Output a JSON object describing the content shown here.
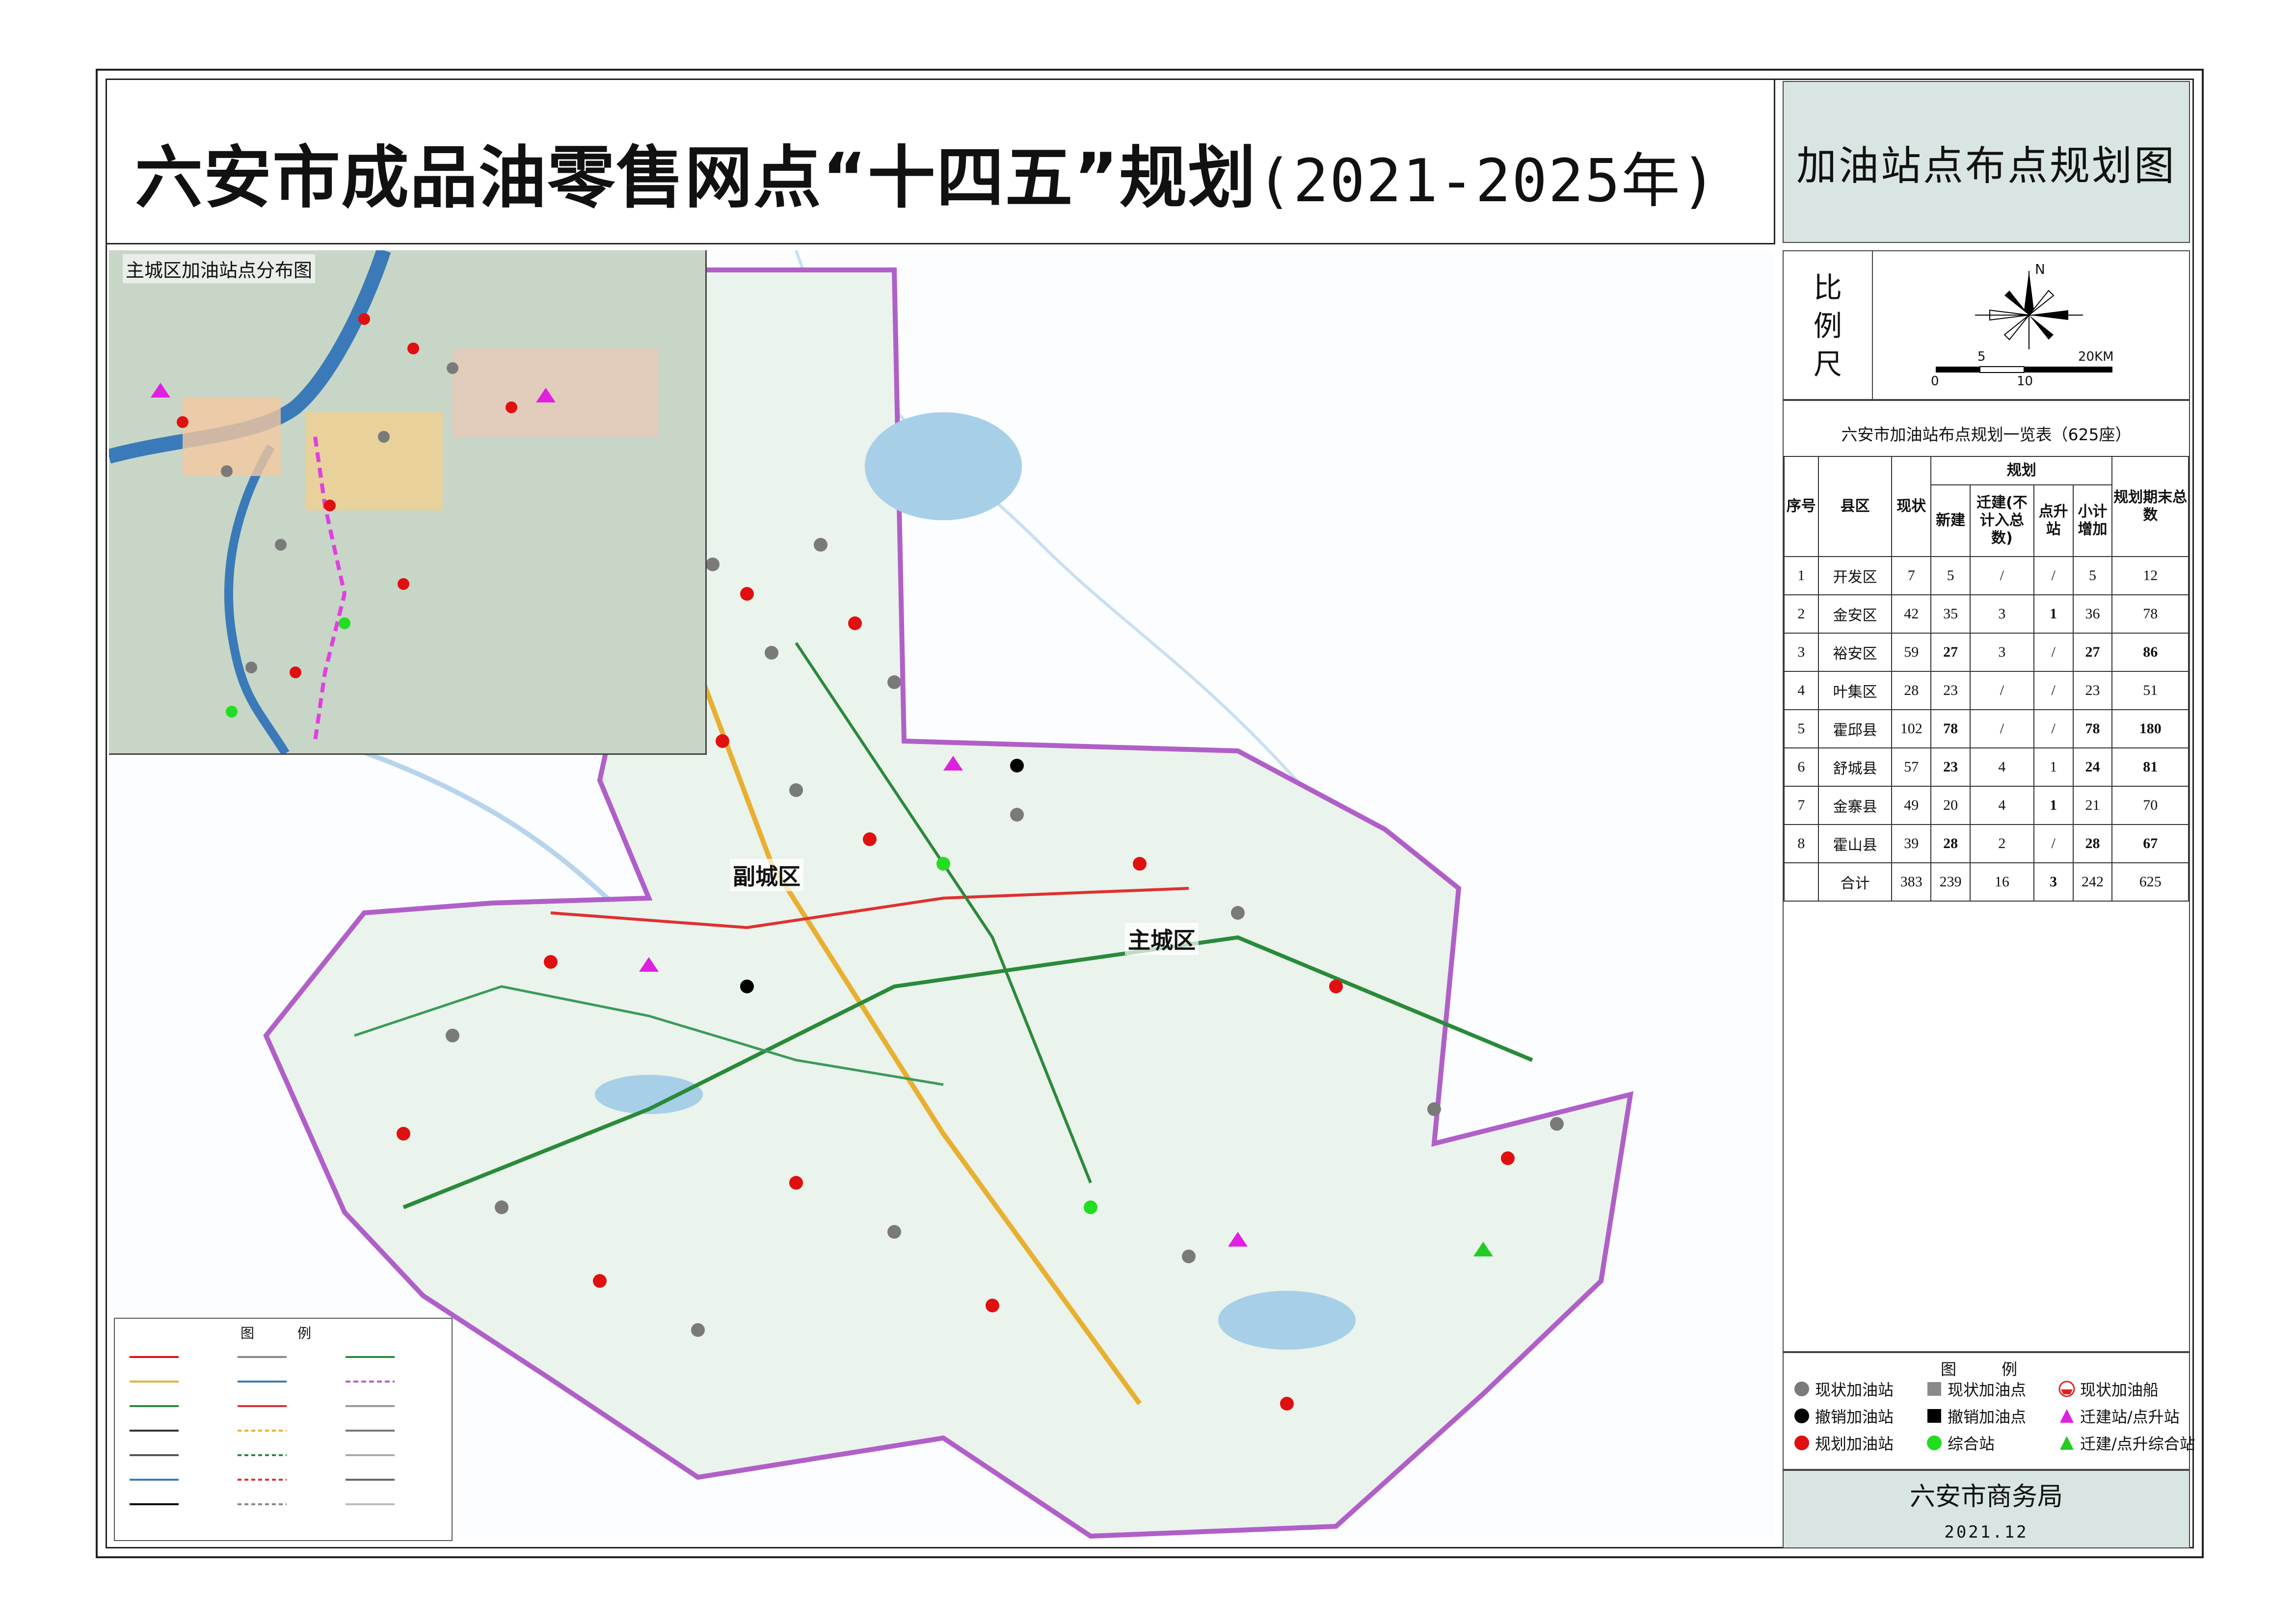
{
  "header": {
    "title_main": "六安市成品油零售网点“十四五”规划",
    "title_years": "(2021-2025年)",
    "subtitle": "加油站点布点规划图"
  },
  "inset": {
    "title": "主城区加油站点分布图"
  },
  "map": {
    "labels": {
      "sub_city": "副城区",
      "main_city": "主城区"
    },
    "legend_title": "图　例"
  },
  "scale": {
    "label": "比例尺",
    "north": "N",
    "ticks": [
      "0",
      "5",
      "10",
      "20KM"
    ]
  },
  "table": {
    "title": "六安市加油站布点规划一览表（625座）",
    "headers": {
      "seq": "序号",
      "district": "县区",
      "current": "现状",
      "plan": "规划",
      "new": "新建",
      "relocate": "迁建(不计入总数)",
      "upgrade": "点升站",
      "subtotal": "小计增加",
      "total": "规划期末总数"
    },
    "rows": [
      {
        "seq": "1",
        "district": "开发区",
        "current": "7",
        "new": "5",
        "relocate": "/",
        "upgrade": "/",
        "subtotal": "5",
        "total": "12"
      },
      {
        "seq": "2",
        "district": "金安区",
        "current": "42",
        "new": "35",
        "relocate": "3",
        "upgrade": "1",
        "subtotal": "36",
        "total": "78"
      },
      {
        "seq": "3",
        "district": "裕安区",
        "current": "59",
        "new": "27",
        "relocate": "3",
        "upgrade": "/",
        "subtotal": "27",
        "total": "86"
      },
      {
        "seq": "4",
        "district": "叶集区",
        "current": "28",
        "new": "23",
        "relocate": "/",
        "upgrade": "/",
        "subtotal": "23",
        "total": "51"
      },
      {
        "seq": "5",
        "district": "霍邱县",
        "current": "102",
        "new": "78",
        "relocate": "/",
        "upgrade": "/",
        "subtotal": "78",
        "total": "180"
      },
      {
        "seq": "6",
        "district": "舒城县",
        "current": "57",
        "new": "23",
        "relocate": "4",
        "upgrade": "1",
        "subtotal": "24",
        "total": "81"
      },
      {
        "seq": "7",
        "district": "金寨县",
        "current": "49",
        "new": "20",
        "relocate": "4",
        "upgrade": "1",
        "subtotal": "21",
        "total": "70"
      },
      {
        "seq": "8",
        "district": "霍山县",
        "current": "39",
        "new": "28",
        "relocate": "2",
        "upgrade": "/",
        "subtotal": "28",
        "total": "67"
      }
    ],
    "total_row": {
      "seq": "",
      "district": "合计",
      "current": "383",
      "new": "239",
      "relocate": "16",
      "upgrade": "3",
      "subtotal": "242",
      "total": "625"
    }
  },
  "legend": {
    "title": "图　例",
    "items": [
      {
        "label": "现状加油站",
        "symbol": "gray-circle",
        "color": "#7a7a7a"
      },
      {
        "label": "现状加油点",
        "symbol": "gray-square",
        "color": "#8a8a8a"
      },
      {
        "label": "现状加油船",
        "symbol": "red-boat",
        "color": "#d22"
      },
      {
        "label": "撤销加油站",
        "symbol": "black-circle",
        "color": "#000000"
      },
      {
        "label": "撤销加油点",
        "symbol": "black-square",
        "color": "#000000"
      },
      {
        "label": "迁建站/点升站",
        "symbol": "magenta-triangle",
        "color": "#e020e0"
      },
      {
        "label": "规划加油站",
        "symbol": "red-circle",
        "color": "#e01010"
      },
      {
        "label": "综合站",
        "symbol": "green-circle",
        "color": "#22dd22"
      },
      {
        "label": "迁建/点升综合站",
        "symbol": "green-triangle",
        "color": "#22cc22"
      }
    ]
  },
  "footer": {
    "org": "六安市商务局",
    "date": "2021.12"
  },
  "colors": {
    "panel_bg": "#d9e5e3",
    "county_fill": "#eaf3ec",
    "boundary": "#b05fc8"
  }
}
